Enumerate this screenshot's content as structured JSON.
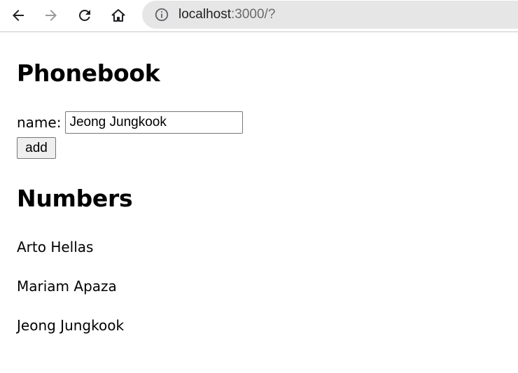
{
  "browser": {
    "url_host": "localhost",
    "url_rest": ":3000/?"
  },
  "page": {
    "title": "Phonebook",
    "form": {
      "name_label": "name:",
      "name_value": "Jeong Jungkook",
      "add_label": "add"
    },
    "numbers_heading": "Numbers",
    "persons": [
      "Arto Hellas",
      "Mariam Apaza",
      "Jeong Jungkook"
    ]
  },
  "icons": {
    "back": "arrow-left-icon",
    "forward": "arrow-right-icon",
    "reload": "reload-icon",
    "home": "home-icon",
    "info": "info-icon"
  }
}
